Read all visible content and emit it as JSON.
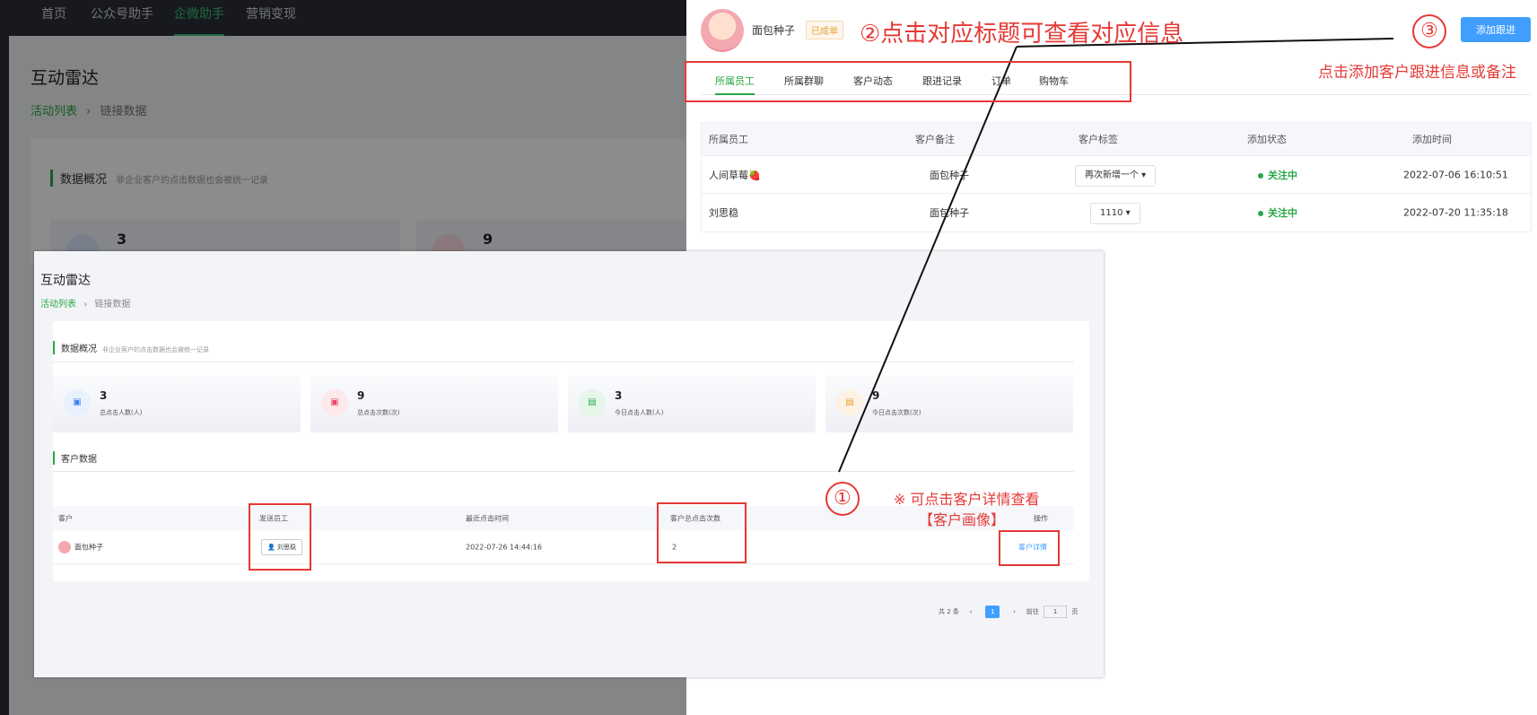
{
  "background": {
    "nav": [
      "首页",
      "公众号助手",
      "企微助手",
      "营销变现"
    ],
    "title": "互动雷达",
    "breadcrumb": [
      "活动列表",
      "链接数据"
    ],
    "section": "数据概况",
    "section_hint": "非企业客户的点击数据也会被统一记录",
    "stats": [
      "3",
      "9"
    ]
  },
  "drawer": {
    "customer_name": "面包种子",
    "badge": "已成单",
    "add_button": "添加跟进",
    "tabs": [
      "所属员工",
      "所属群聊",
      "客户动态",
      "跟进记录",
      "订单",
      "购物车"
    ],
    "table": {
      "headers": [
        "所属员工",
        "客户备注",
        "客户标签",
        "添加状态",
        "添加时间"
      ],
      "rows": [
        {
          "employee": "人间草莓🍓",
          "note": "面包种子",
          "tag": "再次新增一个 ▾",
          "status": "关注中",
          "time": "2022-07-06 16:10:51"
        },
        {
          "employee": "刘思稳",
          "note": "面包种子",
          "tag": "1110 ▾",
          "status": "关注中",
          "time": "2022-07-20 11:35:18"
        }
      ]
    }
  },
  "inset": {
    "title": "互动雷达",
    "breadcrumb": [
      "活动列表",
      "链接数据"
    ],
    "section1": "数据概况",
    "section1_hint": "非企业客户的点击数据也会被统一记录",
    "stats": [
      {
        "value": "3",
        "label": "总点击人数(人)",
        "color": "#e8f1fd",
        "fg": "#3b82f6"
      },
      {
        "value": "9",
        "label": "总点击次数(次)",
        "color": "#fde8ec",
        "fg": "#ef4466"
      },
      {
        "value": "3",
        "label": "今日点击人数(人)",
        "color": "#e6f7ea",
        "fg": "#28a745"
      },
      {
        "value": "9",
        "label": "今日点击次数(次)",
        "color": "#fdf2e3",
        "fg": "#f0a030"
      }
    ],
    "section2": "客户数据",
    "table_headers": [
      "客户",
      "发送员工",
      "最近点击时间",
      "客户总点击次数",
      "操作"
    ],
    "row": {
      "customer": "面包种子",
      "employee": "刘思稳",
      "last_click": "2022-07-26 14:44:16",
      "clicks": "2",
      "action": "客户详情"
    },
    "pager": {
      "total": "共 2 条",
      "prev": "‹",
      "page": "1",
      "next": "›",
      "goto": "前往",
      "goto_value": "1",
      "page_unit": "页"
    }
  },
  "annotations": {
    "step1": "①",
    "step2": "②点击对应标题可查看对应信息",
    "step3": "③",
    "step3_text": "点击添加客户跟进信息或备注",
    "note_line1": "※  可点击客户详情查看",
    "note_line2": "【客户画像】"
  }
}
